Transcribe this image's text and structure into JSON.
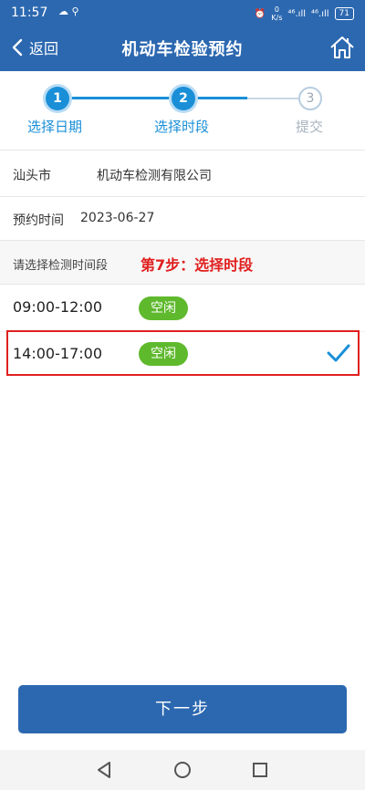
{
  "status_bar": {
    "time": "11:57",
    "left_icons": "☁ ⚲",
    "net_speed_top": "0",
    "net_speed_bottom": "K/s",
    "signal_1": "⁴⁶.ıll",
    "signal_2": "⁴⁶.ıll",
    "battery": "71"
  },
  "header": {
    "back_label": "返回",
    "title": "机动车检验预约",
    "accent_color": "#2c68b0"
  },
  "steps": [
    {
      "number": "1",
      "label": "选择日期",
      "state": "done"
    },
    {
      "number": "2",
      "label": "选择时段",
      "state": "current"
    },
    {
      "number": "3",
      "label": "提交",
      "state": "todo"
    }
  ],
  "info": {
    "station_city": "汕头市",
    "station_name": "机动车检测有限公司",
    "date_label": "预约时间",
    "date_value": "2023-06-27"
  },
  "section": {
    "prompt": "请选择检测时间段",
    "annotation": "第7步：选择时段"
  },
  "slots": [
    {
      "time": "09:00-12:00",
      "status": "空闲",
      "selected": false
    },
    {
      "time": "14:00-17:00",
      "status": "空闲",
      "selected": true
    }
  ],
  "footer": {
    "next_label": "下一步"
  }
}
